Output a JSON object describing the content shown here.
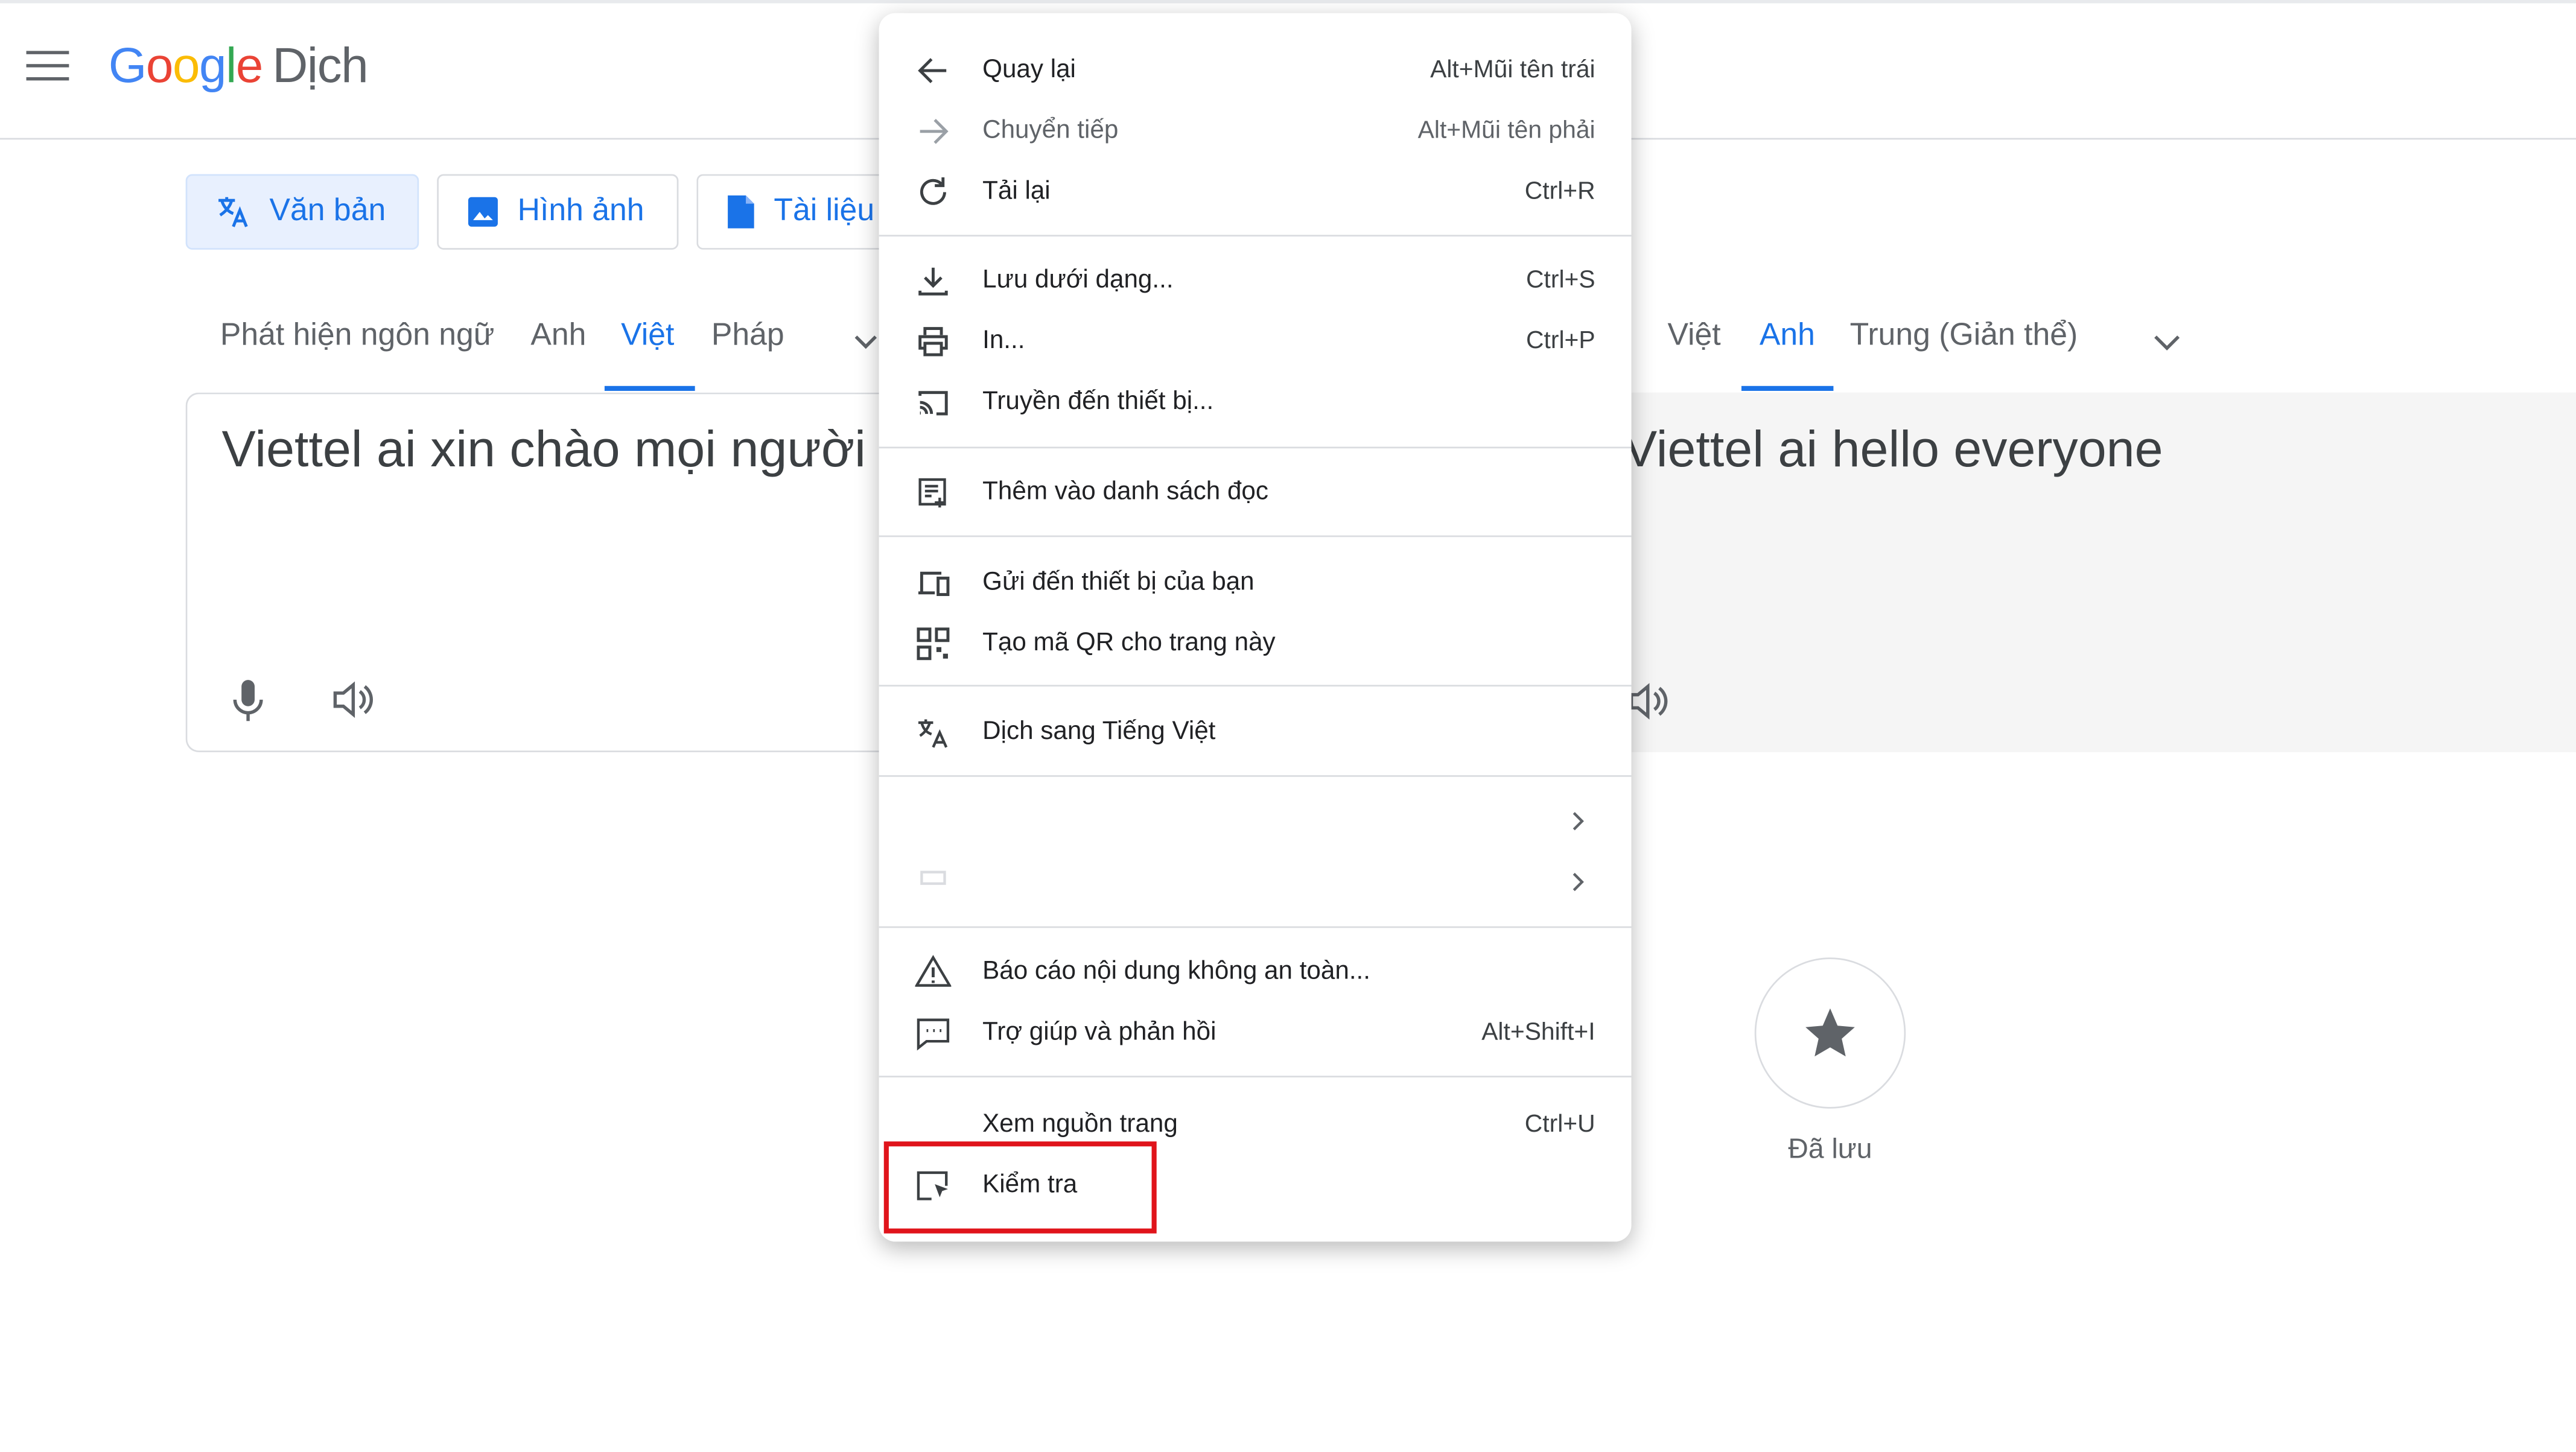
{
  "header": {
    "logo_google": "Google",
    "logo_product": "Dịch"
  },
  "modes": [
    {
      "label": "Văn bản",
      "icon": "translate-icon",
      "active": true
    },
    {
      "label": "Hình ảnh",
      "icon": "image-icon",
      "active": false
    },
    {
      "label": "Tài liệu",
      "icon": "document-icon",
      "active": false
    }
  ],
  "source_langs": [
    "Phát hiện ngôn ngữ",
    "Anh",
    "Việt",
    "Pháp"
  ],
  "target_langs": [
    "Việt",
    "Anh",
    "Trung (Giản thể)"
  ],
  "source_text": "Viettel ai xin chào mọi người",
  "target_text": "Viettel ai hello everyone",
  "saved": {
    "label": "Đã lưu"
  },
  "context_menu": {
    "items": [
      {
        "label": "Quay lại",
        "shortcut": "Alt+Mũi tên trái",
        "icon": "arrow-left-icon"
      },
      {
        "label": "Chuyển tiếp",
        "shortcut": "Alt+Mũi tên phải",
        "icon": "arrow-right-icon",
        "disabled": true
      },
      {
        "label": "Tải lại",
        "shortcut": "Ctrl+R",
        "icon": "reload-icon"
      },
      {
        "label": "Lưu dưới dạng...",
        "shortcut": "Ctrl+S",
        "icon": "download-icon"
      },
      {
        "label": "In...",
        "shortcut": "Ctrl+P",
        "icon": "printer-icon"
      },
      {
        "label": "Truyền đến thiết bị...",
        "shortcut": "",
        "icon": "cast-icon"
      },
      {
        "label": "Thêm vào danh sách đọc",
        "shortcut": "",
        "icon": "reading-list-icon"
      },
      {
        "label": "Gửi đến thiết bị của bạn",
        "shortcut": "",
        "icon": "devices-icon"
      },
      {
        "label": "Tạo mã QR cho trang này",
        "shortcut": "",
        "icon": "qr-code-icon"
      },
      {
        "label": "Dịch sang Tiếng Việt",
        "shortcut": "",
        "icon": "translate-icon"
      },
      {
        "label": "Báo cáo nội dung không an toàn...",
        "shortcut": "",
        "icon": "warning-icon"
      },
      {
        "label": "Trợ giúp và phản hồi",
        "shortcut": "Alt+Shift+I",
        "icon": "feedback-icon"
      },
      {
        "label": "Xem nguồn trang",
        "shortcut": "Ctrl+U",
        "icon": ""
      },
      {
        "label": "Kiểm tra",
        "shortcut": "",
        "icon": "inspect-icon",
        "highlighted": true
      }
    ]
  },
  "colors": {
    "accent": "#1a73e8",
    "highlight_box": "#e0141b"
  }
}
